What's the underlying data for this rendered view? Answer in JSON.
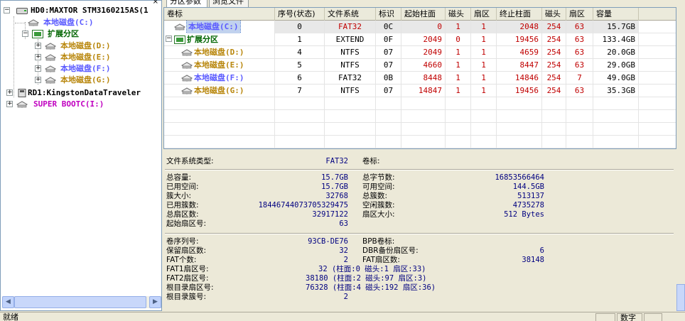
{
  "tree": {
    "close_glyph": "×",
    "nodes": [
      {
        "label": "HD0:MAXTOR STM3160215AS(1",
        "color": "#000000",
        "icon": "hdd-icon",
        "expander": "−"
      },
      {
        "label": "本地磁盘(C:)",
        "color": "#5a5aff",
        "icon": "partition-icon",
        "expander": ""
      },
      {
        "label": "扩展分区",
        "color": "#006400",
        "icon": "extended-partition-icon",
        "expander": "−"
      },
      {
        "label": "本地磁盘(D:)",
        "color": "#b8860b",
        "icon": "partition-icon",
        "expander": "+"
      },
      {
        "label": "本地磁盘(E:)",
        "color": "#b8860b",
        "icon": "partition-icon",
        "expander": "+"
      },
      {
        "label": "本地磁盘(F:)",
        "color": "#5a5aff",
        "icon": "partition-icon",
        "expander": "+"
      },
      {
        "label": "本地磁盘(G:)",
        "color": "#b8860b",
        "icon": "partition-icon",
        "expander": "+"
      },
      {
        "label": "RD1:KingstonDataTraveler",
        "color": "#000000",
        "icon": "usb-drive-icon",
        "expander": "+"
      },
      {
        "label": "SUPER BOOTC(I:)",
        "color": "#c000c0",
        "icon": "partition-icon",
        "expander": "+"
      }
    ],
    "scroll_left": "◀",
    "scroll_right": "▶"
  },
  "tabs": [
    "分区参数",
    "浏览文件"
  ],
  "grid": {
    "headers": [
      "卷标",
      "序号(状态)",
      "文件系统",
      "标识",
      "起始柱面",
      "磁头",
      "扇区",
      "终止柱面",
      "磁头",
      "扇区",
      "容量"
    ],
    "rows": [
      {
        "name": "本地磁盘(C:)",
        "name_color": "#5a5aff",
        "seq": "0",
        "fs": "FAT32",
        "fs_color": "#c00000",
        "id": "0C",
        "start_cyl": "0",
        "start_head": "1",
        "start_sec": "1",
        "end_cyl": "2048",
        "end_head": "254",
        "end_sec": "63",
        "capacity": "15.7GB",
        "selected": true,
        "indent": 1,
        "icon": "partition-icon"
      },
      {
        "name": "扩展分区",
        "name_color": "#006400",
        "seq": "1",
        "fs": "EXTEND",
        "fs_color": "#000000",
        "id": "0F",
        "start_cyl": "2049",
        "start_head": "0",
        "start_sec": "1",
        "end_cyl": "19456",
        "end_head": "254",
        "end_sec": "63",
        "capacity": "133.4GB",
        "selected": false,
        "indent": 0,
        "icon": "extended-partition-icon"
      },
      {
        "name": "本地磁盘(D:)",
        "name_color": "#b8860b",
        "seq": "4",
        "fs": "NTFS",
        "fs_color": "#000000",
        "id": "07",
        "start_cyl": "2049",
        "start_head": "1",
        "start_sec": "1",
        "end_cyl": "4659",
        "end_head": "254",
        "end_sec": "63",
        "capacity": "20.0GB",
        "selected": false,
        "indent": 2,
        "icon": "partition-icon"
      },
      {
        "name": "本地磁盘(E:)",
        "name_color": "#b8860b",
        "seq": "5",
        "fs": "NTFS",
        "fs_color": "#000000",
        "id": "07",
        "start_cyl": "4660",
        "start_head": "1",
        "start_sec": "1",
        "end_cyl": "8447",
        "end_head": "254",
        "end_sec": "63",
        "capacity": "29.0GB",
        "selected": false,
        "indent": 2,
        "icon": "partition-icon"
      },
      {
        "name": "本地磁盘(F:)",
        "name_color": "#5a5aff",
        "seq": "6",
        "fs": "FAT32",
        "fs_color": "#000000",
        "id": "0B",
        "start_cyl": "8448",
        "start_head": "1",
        "start_sec": "1",
        "end_cyl": "14846",
        "end_head": "254",
        "end_sec": "7",
        "capacity": "49.0GB",
        "selected": false,
        "indent": 2,
        "icon": "partition-icon"
      },
      {
        "name": "本地磁盘(G:)",
        "name_color": "#b8860b",
        "seq": "7",
        "fs": "NTFS",
        "fs_color": "#000000",
        "id": "07",
        "start_cyl": "14847",
        "start_head": "1",
        "start_sec": "1",
        "end_cyl": "19456",
        "end_head": "254",
        "end_sec": "63",
        "capacity": "35.3GB",
        "selected": false,
        "indent": 2,
        "icon": "partition-icon"
      }
    ]
  },
  "info": {
    "fs_type_label": "文件系统类型:",
    "fs_type_value": "FAT32",
    "volume_label_label": "卷标:",
    "total_capacity_label": "总容量:",
    "total_capacity": "15.7GB",
    "used_space_label": "已用空间:",
    "used_space": "15.7GB",
    "cluster_size_label": "簇大小:",
    "cluster_size": "32768",
    "used_clusters_label": "已用簇数:",
    "used_clusters": "18446744073705329475",
    "total_sectors_label": "总扇区数:",
    "total_sectors": "32917122",
    "start_sector_label": "起始扇区号:",
    "start_sector": "63",
    "total_bytes_label": "总字节数:",
    "total_bytes": "16853566464",
    "free_space_label": "可用空间:",
    "free_space": "144.5GB",
    "total_clusters_label": "总簇数:",
    "total_clusters": "513137",
    "free_clusters_label": "空闲簇数:",
    "free_clusters": "4735278",
    "sector_size_label": "扇区大小:",
    "sector_size": "512 Bytes",
    "serial_label": "卷序列号:",
    "serial": "93CB-DE76",
    "bpb_label": "BPB卷标:",
    "reserved_label": "保留扇区数:",
    "reserved": "32",
    "dbr_backup_label": "DBR备份扇区号:",
    "dbr_backup": "6",
    "fat_count_label": "FAT个数:",
    "fat_count": "2",
    "fat_sectors_label": "FAT扇区数:",
    "fat_sectors": "38148",
    "fat1_label": "FAT1扇区号:",
    "fat1": "32 (柱面:0 磁头:1 扇区:33)",
    "fat2_label": "FAT2扇区号:",
    "fat2": "38180 (柱面:2 磁头:97 扇区:3)",
    "root_sector_label": "根目录扇区号:",
    "root_sector": "76328 (柱面:4 磁头:192 扇区:36)",
    "root_cluster_label": "根目录簇号:",
    "root_cluster": "2"
  },
  "status": {
    "ready": "就绪",
    "num": "数字"
  }
}
